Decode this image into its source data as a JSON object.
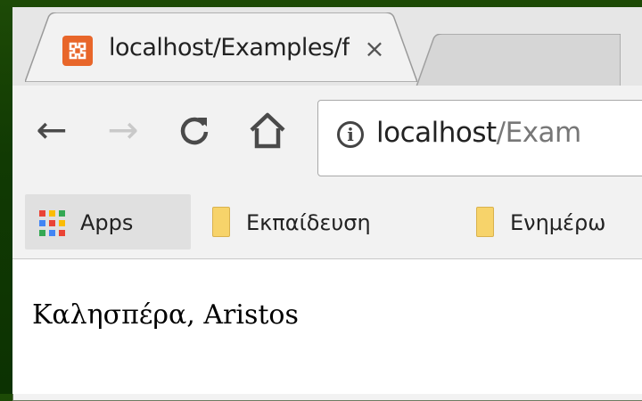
{
  "browser": {
    "tab": {
      "title": "localhost/Examples/form",
      "close_glyph": "×",
      "favicon": "xampp-icon"
    },
    "nav": {
      "back_glyph": "←",
      "forward_glyph": "→",
      "reload_glyph": "C",
      "home_glyph": "⌂"
    },
    "omnibox": {
      "info_glyph": "i",
      "url_host": "localhost",
      "url_path": "/Exam"
    },
    "bookmarks": [
      {
        "label": "Apps",
        "icon": "apps-grid-icon"
      },
      {
        "label": "Εκπαίδευση",
        "icon": "folder-icon"
      },
      {
        "label": "Ενημέρω",
        "icon": "folder-icon"
      }
    ]
  },
  "page": {
    "greeting": "Καλησπέρα, Aristos"
  },
  "colors": {
    "desktop_bg": "#113a03",
    "favicon_orange": "#e8662a",
    "folder_yellow": "#f7d36a"
  }
}
